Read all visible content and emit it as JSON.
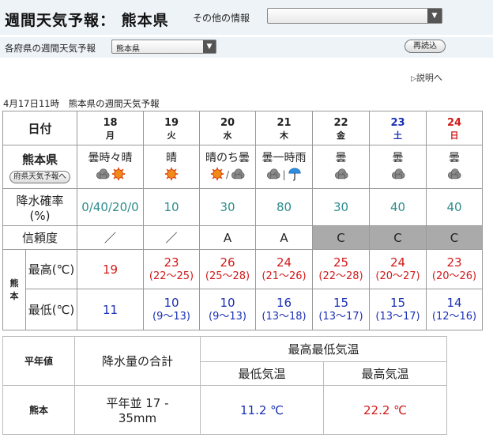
{
  "header": {
    "title": "週間天気予報： 熊本県",
    "other_info_label": "その他の情報",
    "other_info_value": ""
  },
  "subbar": {
    "pref_label": "各府県の週間天気予報",
    "pref_select_value": "熊本県",
    "reload_label": "再読込"
  },
  "help_link": "説明へ",
  "issued": "4月17日11時　熊本県の週間天気予報",
  "table": {
    "date_header": "日付",
    "region": "熊本県",
    "pref_button": "府県天気予報へ",
    "pop_label": "降水確率",
    "pop_unit": "(%)",
    "reliability_label": "信頼度",
    "area_char1": "熊",
    "area_char2": "本",
    "max_label": "最高(℃)",
    "min_label": "最低(℃)",
    "days": [
      {
        "day": "18",
        "dow": "月",
        "weather": "曇時々晴",
        "icons": [
          "cloud-icon",
          "sun-icon"
        ],
        "sep": "",
        "pop": "0/40/20/0",
        "rel": "",
        "max": "19",
        "max_range": "",
        "min": "11",
        "min_range": ""
      },
      {
        "day": "19",
        "dow": "火",
        "weather": "晴",
        "icons": [
          "sun-icon"
        ],
        "sep": "",
        "pop": "10",
        "rel": "／",
        "max": "23",
        "max_range": "(22〜25)",
        "min": "10",
        "min_range": "(9〜13)"
      },
      {
        "day": "20",
        "dow": "水",
        "weather": "晴のち曇",
        "icons": [
          "sun-icon",
          "cloud-icon"
        ],
        "sep": "/",
        "pop": "30",
        "rel": "A",
        "max": "26",
        "max_range": "(25〜28)",
        "min": "10",
        "min_range": "(9〜13)"
      },
      {
        "day": "21",
        "dow": "木",
        "weather": "曇一時雨",
        "icons": [
          "cloud-icon",
          "umbrella-icon"
        ],
        "sep": "|",
        "pop": "80",
        "rel": "A",
        "max": "24",
        "max_range": "(21〜26)",
        "min": "16",
        "min_range": "(13〜18)"
      },
      {
        "day": "22",
        "dow": "金",
        "weather": "曇",
        "icons": [
          "cloud-icon"
        ],
        "sep": "",
        "pop": "30",
        "rel": "C",
        "max": "25",
        "max_range": "(22〜28)",
        "min": "15",
        "min_range": "(13〜17)"
      },
      {
        "day": "23",
        "dow": "土",
        "weather": "曇",
        "icons": [
          "cloud-icon"
        ],
        "sep": "",
        "pop": "40",
        "rel": "C",
        "max": "24",
        "max_range": "(20〜27)",
        "min": "15",
        "min_range": "(13〜17)"
      },
      {
        "day": "24",
        "dow": "日",
        "weather": "曇",
        "icons": [
          "cloud-icon"
        ],
        "sep": "",
        "pop": "40",
        "rel": "C",
        "max": "23",
        "max_range": "(20〜26)",
        "min": "14",
        "min_range": "(12〜16)"
      }
    ],
    "day1_rel": "／"
  },
  "normals": {
    "label": "平年値",
    "precip_header": "降水量の合計",
    "temp_header": "最高最低気温",
    "min_header": "最低気温",
    "max_header": "最高気温",
    "station": "熊本",
    "precip_line1": "平年並 17 -",
    "precip_line2": "35mm",
    "min_value": "11.2 ℃",
    "max_value": "22.2 ℃"
  },
  "colors": {
    "header_bg": "#eef3f8",
    "pop_text": "#2e8c8c",
    "max_temp": "#d21a1a",
    "min_temp": "#1a2fb4",
    "saturday": "#1a2fb4",
    "sunday": "#d21a1a",
    "low_reliability_bg": "#aaaaaa"
  }
}
